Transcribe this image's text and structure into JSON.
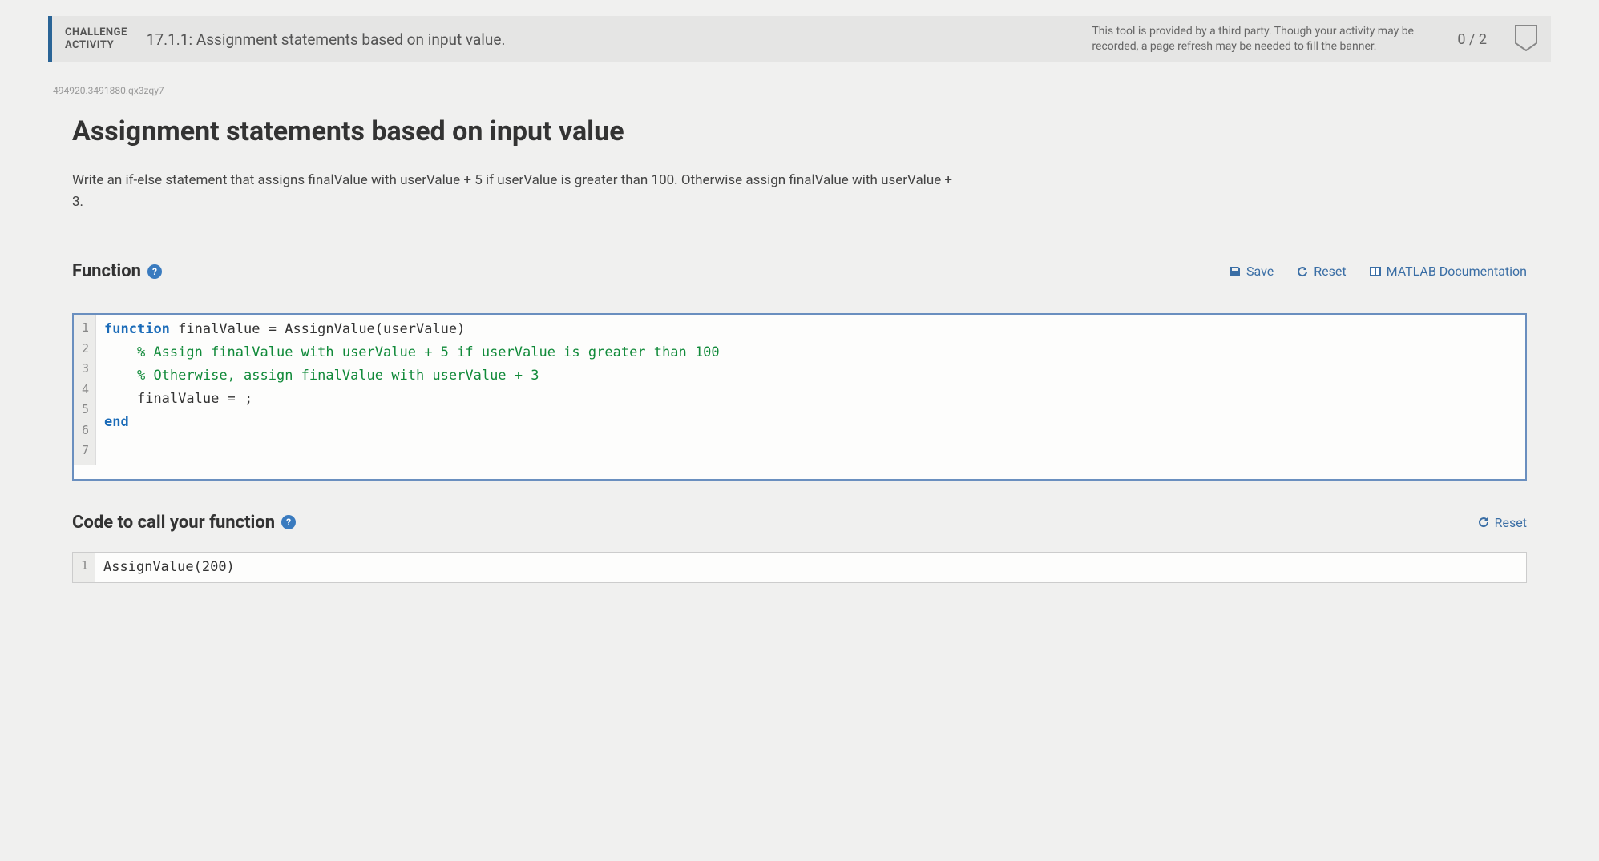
{
  "header": {
    "badge_line1": "CHALLENGE",
    "badge_line2": "ACTIVITY",
    "title": "17.1.1: Assignment statements based on input value.",
    "third_party": "This tool is provided by a third party. Though your activity may be recorded, a page refresh may be needed to fill the banner.",
    "score": "0 / 2"
  },
  "tracking_id": "494920.3491880.qx3zqy7",
  "main": {
    "title": "Assignment statements based on input value",
    "prompt": "Write an if-else statement that assigns finalValue with userValue + 5 if userValue is greater than 100. Otherwise assign finalValue with userValue + 3."
  },
  "function_section": {
    "label": "Function",
    "save": "Save",
    "reset": "Reset",
    "docs": "MATLAB Documentation"
  },
  "editor": {
    "line_numbers": [
      "1",
      "2",
      "3",
      "4",
      "5",
      "6",
      "7"
    ],
    "lines": {
      "l1_kw": "function",
      "l1_rest": " finalValue = AssignValue(userValue)",
      "l2": "",
      "l3": "    % Assign finalValue with userValue + 5 if userValue is greater than 100",
      "l4": "    % Otherwise, assign finalValue with userValue + 3",
      "l5_pre": "    finalValue = ",
      "l5_post": ";",
      "l6": "",
      "l7": "end"
    }
  },
  "call_section": {
    "label": "Code to call your function",
    "reset": "Reset"
  },
  "call_editor": {
    "line_numbers": [
      "1"
    ],
    "line1": "AssignValue(200)"
  }
}
